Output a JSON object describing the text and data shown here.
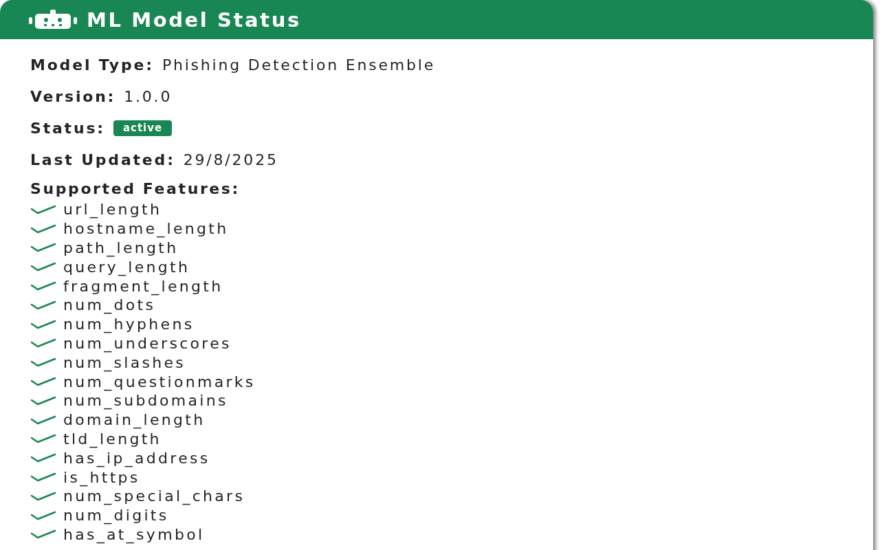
{
  "card": {
    "title": "ML Model Status",
    "fields": [
      {
        "kind": "text",
        "label": "Model Type:",
        "value": "Phishing Detection Ensemble"
      },
      {
        "kind": "text",
        "label": "Version:",
        "value": "1.0.0"
      },
      {
        "kind": "badge",
        "label": "Status:",
        "value": "active"
      },
      {
        "kind": "text",
        "label": "Last Updated:",
        "value": "29/8/2025"
      }
    ],
    "features_heading": "Supported Features:",
    "features": [
      "url_length",
      "hostname_length",
      "path_length",
      "query_length",
      "fragment_length",
      "num_dots",
      "num_hyphens",
      "num_underscores",
      "num_slashes",
      "num_questionmarks",
      "num_subdomains",
      "domain_length",
      "tld_length",
      "has_ip_address",
      "is_https",
      "num_special_chars",
      "num_digits",
      "has_at_symbol"
    ]
  }
}
